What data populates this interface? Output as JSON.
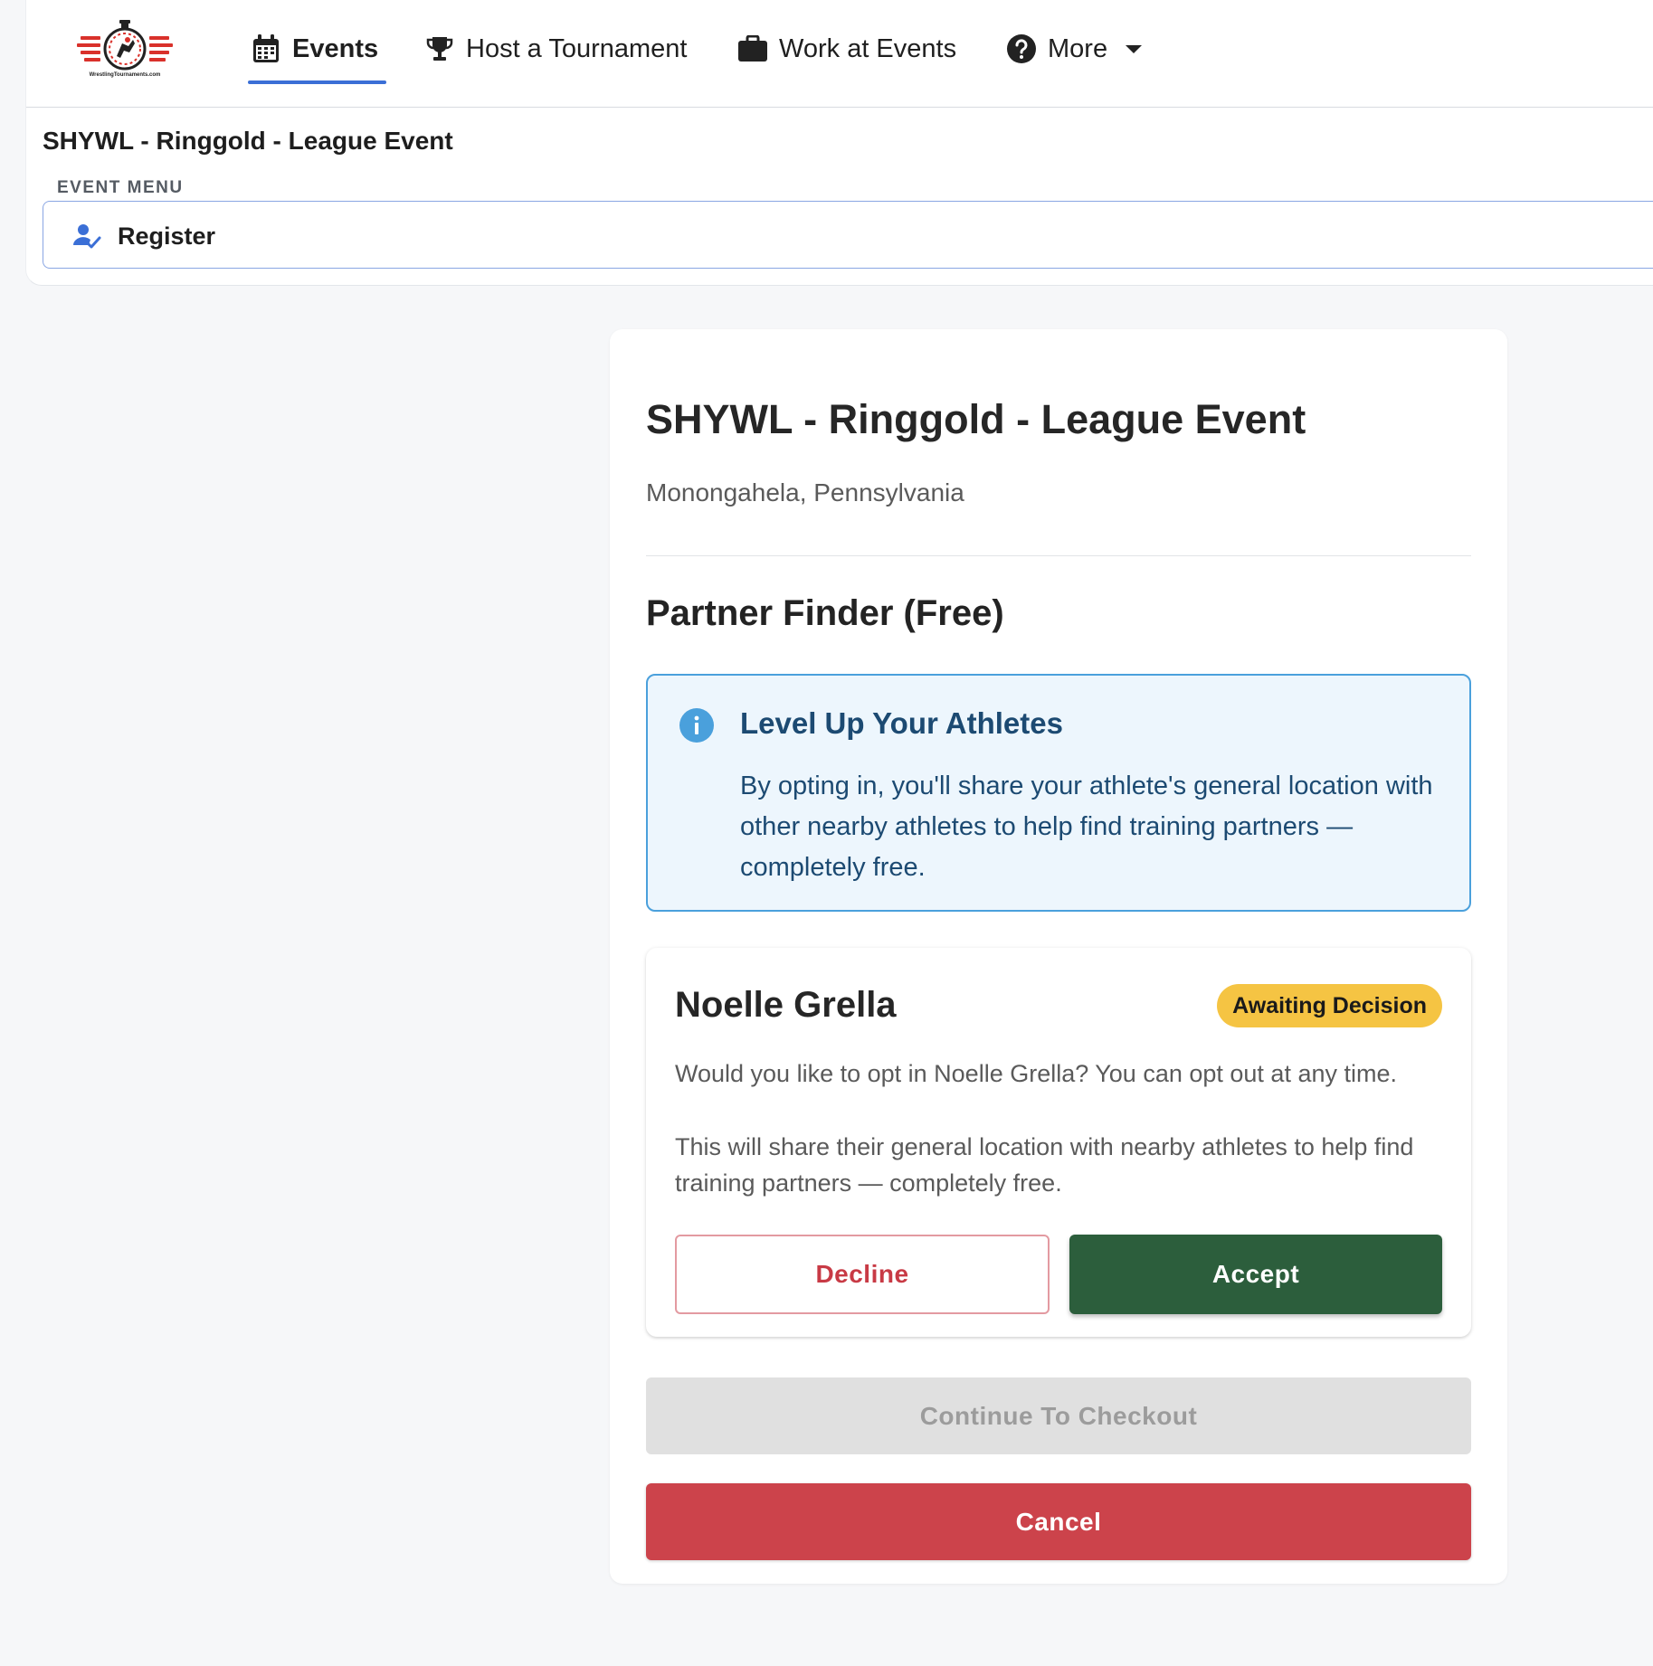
{
  "nav": {
    "logo_text": "WrestlingTournaments.com",
    "items": [
      {
        "label": "Events",
        "icon": "calendar-icon",
        "active": true
      },
      {
        "label": "Host a Tournament",
        "icon": "trophy-icon",
        "active": false
      },
      {
        "label": "Work at Events",
        "icon": "briefcase-icon",
        "active": false
      },
      {
        "label": "More",
        "icon": "help-circle-icon",
        "active": false
      }
    ]
  },
  "event_header": {
    "title": "SHYWL - Ringgold - League Event",
    "menu_label": "EVENT MENU",
    "menu_item": {
      "label": "Register",
      "icon": "user-check-icon"
    }
  },
  "card": {
    "title": "SHYWL - Ringgold - League Event",
    "location": "Monongahela, Pennsylvania",
    "section_title": "Partner Finder (Free)",
    "info": {
      "icon": "info-icon",
      "title": "Level Up Your Athletes",
      "text": "By opting in, you'll share your athlete's general location with other nearby athletes to help find training partners — completely free."
    },
    "athlete": {
      "name": "Noelle Grella",
      "status": "Awaiting Decision",
      "question": "Would you like to opt in Noelle Grella? You can opt out at any time.",
      "note": "This will share their general location with nearby athletes to help find training partners — completely free.",
      "decline_label": "Decline",
      "accept_label": "Accept"
    },
    "checkout_label": "Continue To Checkout",
    "checkout_disabled": true,
    "cancel_label": "Cancel"
  },
  "colors": {
    "accent_blue": "#3b6fd6",
    "info_border": "#4aa0dc",
    "accept_green": "#2c5e3c",
    "cancel_red": "#cc434b",
    "badge_yellow": "#f5c443"
  }
}
